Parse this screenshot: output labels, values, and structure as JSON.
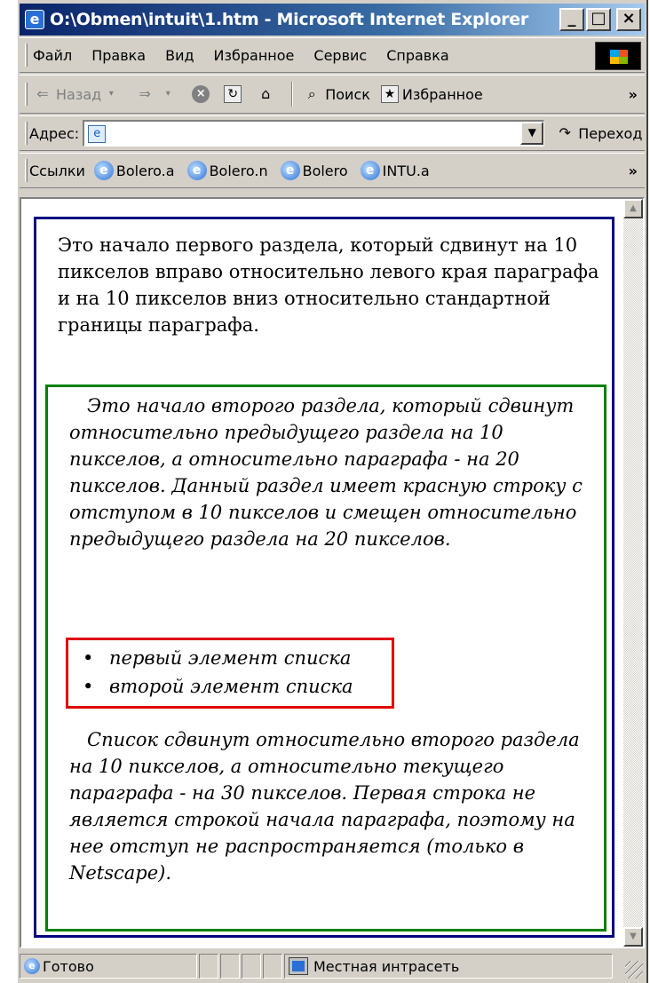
{
  "window": {
    "title": "O:\\Obmen\\intuit\\1.htm - Microsoft Internet Explorer",
    "buttons": {
      "minimize": "_",
      "maximize": "□",
      "close": "×"
    }
  },
  "menubar": {
    "items": [
      "Файл",
      "Правка",
      "Вид",
      "Избранное",
      "Сервис",
      "Справка"
    ]
  },
  "toolbar": {
    "back_label": "Назад",
    "search_label": "Поиск",
    "favorites_label": "Избранное",
    "more": "»"
  },
  "addressbar": {
    "label": "Адрес:",
    "value": "",
    "go_label": "Переход"
  },
  "linksbar": {
    "label": "Ссылки",
    "links": [
      "Bolero.a",
      "Bolero.n",
      "Bolero",
      "INTU.a"
    ],
    "more": "»"
  },
  "content": {
    "section1": "Это начало первого раздела, который сдвинут на 10 пикселов вправо относительно левого края параграфа и на 10 пикселов вниз относительно стандартной границы параграфа.",
    "section2": "Это начало второго раздела, который сдвинут относительно предыдущего раздела на 10 пикселов, а относительно параграфа - на 20 пикселов. Данный раздел имеет красную строку с отступом в 10 пикселов и смещен относительно предыдущего раздела на 20 пикселов.",
    "list": [
      "первый элемент списка",
      "второй элемент списка"
    ],
    "section2_tail": "Список сдвинут относительно второго раздела на 10 пикселов, а относительно текущего параграфа - на 30 пикселов. Первая строка не является строкой начала параграфа, поэтому на нее отступ не распространяется (только в Netscape).",
    "colors": {
      "paragraph_border": "#000080",
      "section2_border": "#008000",
      "list_border": "#e00000"
    }
  },
  "statusbar": {
    "status": "Готово",
    "zone": "Местная интрасеть"
  }
}
